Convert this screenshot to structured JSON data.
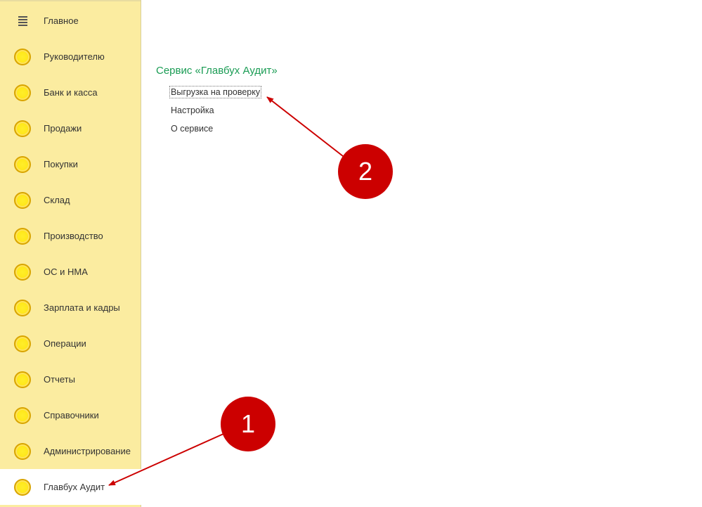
{
  "sidebar": {
    "menu_label": "Главное",
    "items": [
      {
        "label": "Руководителю"
      },
      {
        "label": "Банк и касса"
      },
      {
        "label": "Продажи"
      },
      {
        "label": "Покупки"
      },
      {
        "label": "Склад"
      },
      {
        "label": "Производство"
      },
      {
        "label": "ОС и НМА"
      },
      {
        "label": "Зарплата и кадры"
      },
      {
        "label": "Операции"
      },
      {
        "label": "Отчеты"
      },
      {
        "label": "Справочники"
      },
      {
        "label": "Администрирование"
      },
      {
        "label": "Главбух Аудит",
        "active": true
      }
    ],
    "icon": "coin-icon",
    "menu_icon": "hamburger-icon"
  },
  "main": {
    "section_title": "Сервис «Главбух Аудит»",
    "links": [
      {
        "label": "Выгрузка на проверку"
      },
      {
        "label": "Настройка"
      },
      {
        "label": "О сервисе"
      }
    ]
  },
  "annotations": {
    "step1": "1",
    "step2": "2",
    "color": "#cc0000"
  },
  "colors": {
    "sidebar_bg": "#fbeca0",
    "title_green": "#1a9c54"
  }
}
